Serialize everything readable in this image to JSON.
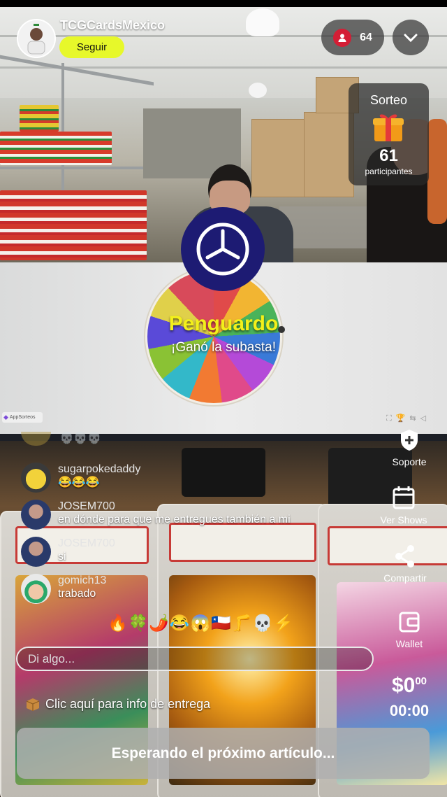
{
  "streamer": {
    "name": "TCGCardsMexico",
    "follow_label": "Seguir"
  },
  "viewers": {
    "count": "64"
  },
  "giveaway": {
    "title": "Sorteo",
    "count": "61",
    "label": "participantes"
  },
  "auction": {
    "winner": "Penguardo",
    "message": "¡Ganó la subasta!",
    "app_badge": "AppSorteos"
  },
  "chat": {
    "faded_text": "💀💀💀",
    "messages": [
      {
        "user": "sugarpokedaddy",
        "text": "😂😂😂"
      },
      {
        "user": "JOSEM700",
        "text": "en dónde para que me entregues también a mi"
      },
      {
        "user": "JOSEM700",
        "text": "si"
      },
      {
        "user": "gomich13",
        "text": "trabado"
      }
    ],
    "reactions": "🔥🍀🌶️😂😱🇨🇱🦵💀⚡",
    "input_placeholder": "Di algo...",
    "delivery_info": "Clic aquí para info de entrega"
  },
  "actions": {
    "support": "Soporte",
    "shows": "Ver Shows",
    "share": "Compartir",
    "wallet": "Wallet"
  },
  "price": {
    "main": "$0",
    "cents": "00",
    "timer": "00:00"
  },
  "status": {
    "waiting": "Esperando el próximo artículo..."
  },
  "colors": {
    "follow": "#e7f82a",
    "winner": "#f3f01a",
    "timer": "#1d1b73",
    "viewer_badge": "#d41e35"
  },
  "icons": [
    "user-icon",
    "chevron-down-icon",
    "gift-icon",
    "timer-icon",
    "support-icon",
    "calendar-icon",
    "share-icon",
    "wallet-icon",
    "package-icon"
  ]
}
